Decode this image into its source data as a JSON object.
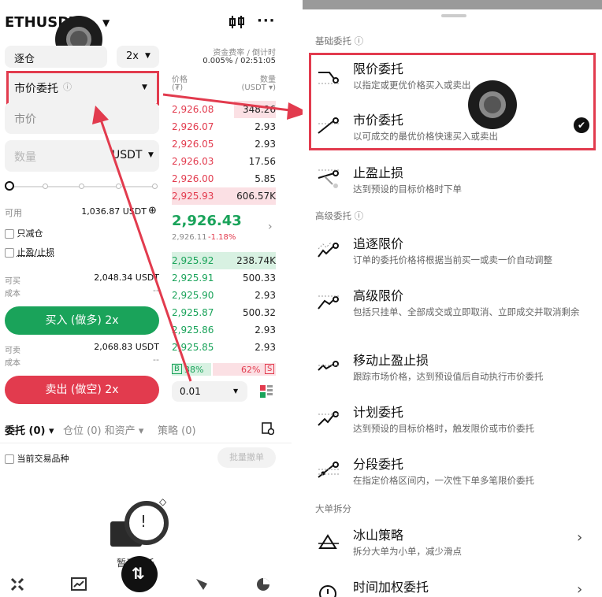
{
  "left": {
    "symbol": "ETHUSDT",
    "margin_mode": "逐仓",
    "leverage": "2x",
    "funding_label": "资金费率 / 倒计时",
    "funding_value": "0.005% / 02:51:05",
    "order_type": "市价委托",
    "price_field": "市价",
    "qty_placeholder": "数量",
    "qty_unit": "USDT",
    "available_label": "可用",
    "available_value": "1,036.87 USDT",
    "reduce_only": "只减仓",
    "tp_sl": "止盈/止损",
    "can_buy_label": "可买",
    "can_buy_value": "2,048.34 USDT",
    "cost_label": "成本",
    "cost_value": "--",
    "buy_button": "买入 (做多) 2x",
    "can_sell_label": "可卖",
    "can_sell_value": "2,068.83 USDT",
    "cost2_label": "成本",
    "cost2_value": "--",
    "sell_button": "卖出 (做空) 2x",
    "orderbook": {
      "price_header": "价格",
      "price_unit": "(₮)",
      "qty_header": "数量",
      "qty_unit": "(USDT ▾)",
      "asks": [
        {
          "price": "2,926.08",
          "qty": "348.26"
        },
        {
          "price": "2,926.07",
          "qty": "2.93"
        },
        {
          "price": "2,926.05",
          "qty": "2.93"
        },
        {
          "price": "2,926.03",
          "qty": "17.56"
        },
        {
          "price": "2,926.00",
          "qty": "5.85"
        },
        {
          "price": "2,925.93",
          "qty": "606.57K"
        }
      ],
      "last_price": "2,926.43",
      "mark_price": "2,926.11",
      "change": "-1.18%",
      "bids": [
        {
          "price": "2,925.92",
          "qty": "238.74K"
        },
        {
          "price": "2,925.91",
          "qty": "500.33"
        },
        {
          "price": "2,925.90",
          "qty": "2.93"
        },
        {
          "price": "2,925.87",
          "qty": "500.32"
        },
        {
          "price": "2,925.86",
          "qty": "2.93"
        },
        {
          "price": "2,925.85",
          "qty": "2.93"
        }
      ],
      "buy_ratio_label": "B",
      "buy_ratio": "38%",
      "sell_ratio": "62%",
      "sell_ratio_label": "S",
      "precision": "0.01"
    },
    "tabs": {
      "orders": "委托 (0)",
      "positions": "仓位 (0) 和资产",
      "strategy": "策略 (0)"
    },
    "current_symbol_only": "当前交易品种",
    "batch_cancel": "批量撤单",
    "empty_text": "暂无委托"
  },
  "right": {
    "section_basic": "基础委托",
    "section_advanced": "高级委托",
    "section_large": "大单拆分",
    "items": [
      {
        "title": "限价委托",
        "desc": "以指定或更优价格买入或卖出"
      },
      {
        "title": "市价委托",
        "desc": "以可成交的最优价格快速买入或卖出"
      },
      {
        "title": "止盈止损",
        "desc": "达到预设的目标价格时下单"
      },
      {
        "title": "追逐限价",
        "desc": "订单的委托价格将根据当前买一或卖一价自动调整"
      },
      {
        "title": "高级限价",
        "desc": "包括只挂单、全部成交或立即取消、立即成交并取消剩余"
      },
      {
        "title": "移动止盈止损",
        "desc": "跟踪市场价格，达到预设值后自动执行市价委托"
      },
      {
        "title": "计划委托",
        "desc": "达到预设的目标价格时，触发限价或市价委托"
      },
      {
        "title": "分段委托",
        "desc": "在指定价格区间内，一次性下单多笔限价委托"
      },
      {
        "title": "冰山策略",
        "desc": "拆分大单为小单，减少滑点"
      },
      {
        "title": "时间加权委托",
        "desc": ""
      }
    ]
  },
  "colors": {
    "buy": "#1aa35a",
    "sell": "#e23b4e",
    "highlight": "#e23b4e"
  }
}
